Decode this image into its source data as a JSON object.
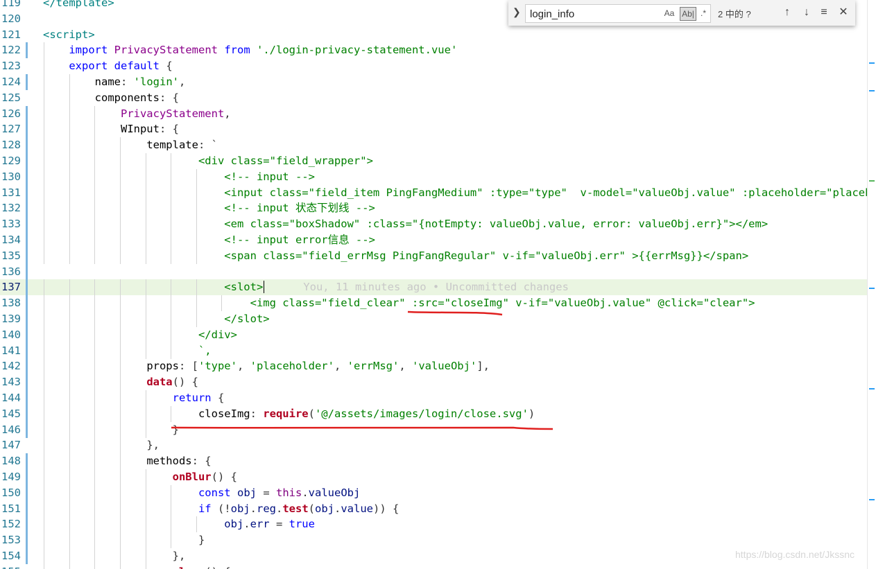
{
  "find_widget": {
    "query": "login_info",
    "match_case_label": "Aa",
    "whole_word_label": "Ab|",
    "regex_label": ".*",
    "result_count": "2 中的 ?"
  },
  "blame": "You, 11 minutes ago • Uncommitted changes",
  "watermark": "https://blog.csdn.net/Jkssnc",
  "line_numbers": [
    "119",
    "120",
    "121",
    "122",
    "123",
    "124",
    "125",
    "126",
    "127",
    "128",
    "129",
    "130",
    "131",
    "132",
    "133",
    "134",
    "135",
    "136",
    "137",
    "138",
    "139",
    "140",
    "141",
    "142",
    "143",
    "144",
    "145",
    "146",
    "147",
    "148",
    "149",
    "150",
    "151",
    "152",
    "153",
    "154",
    "155"
  ],
  "lines": [
    [
      [
        "</template>",
        "t-tag"
      ]
    ],
    [],
    [
      [
        "<script>",
        "t-tag"
      ]
    ],
    [
      [
        "    ",
        ""
      ],
      [
        "import",
        "t-kw"
      ],
      [
        " ",
        ""
      ],
      [
        "PrivacyStatement",
        "t-comp"
      ],
      [
        " ",
        ""
      ],
      [
        "from",
        "t-kw"
      ],
      [
        " ",
        ""
      ],
      [
        "'./login-privacy-statement.vue'",
        "t-str"
      ]
    ],
    [
      [
        "    ",
        ""
      ],
      [
        "export",
        "t-kw"
      ],
      [
        " ",
        ""
      ],
      [
        "default",
        "t-kw"
      ],
      [
        " {",
        "t-punc"
      ]
    ],
    [
      [
        "        ",
        ""
      ],
      [
        "name",
        "t-prop"
      ],
      [
        ": ",
        "t-punc"
      ],
      [
        "'login'",
        "t-str"
      ],
      [
        ",",
        "t-punc"
      ]
    ],
    [
      [
        "        ",
        ""
      ],
      [
        "components",
        "t-prop"
      ],
      [
        ": {",
        "t-punc"
      ]
    ],
    [
      [
        "            ",
        ""
      ],
      [
        "PrivacyStatement",
        "t-comp"
      ],
      [
        ",",
        "t-punc"
      ]
    ],
    [
      [
        "            ",
        ""
      ],
      [
        "WInput",
        "t-prop"
      ],
      [
        ": {",
        "t-punc"
      ]
    ],
    [
      [
        "                ",
        ""
      ],
      [
        "template",
        "t-prop"
      ],
      [
        ": `",
        "t-punc"
      ]
    ],
    [
      [
        "                        ",
        ""
      ],
      [
        "<div class=\"field_wrapper\">",
        "t-str"
      ]
    ],
    [
      [
        "                            ",
        ""
      ],
      [
        "<!-- input -->",
        "t-str"
      ]
    ],
    [
      [
        "                            ",
        ""
      ],
      [
        "<input class=\"field_item PingFangMedium\" :type=\"type\"  v-model=\"valueObj.value\" :placeholder=\"placeholder\"",
        "t-str"
      ]
    ],
    [
      [
        "                            ",
        ""
      ],
      [
        "<!-- input 状态下划线 -->",
        "t-str"
      ]
    ],
    [
      [
        "                            ",
        ""
      ],
      [
        "<em class=\"boxShadow\" :class=\"{notEmpty: valueObj.value, error: valueObj.err}\"></em>",
        "t-str"
      ]
    ],
    [
      [
        "                            ",
        ""
      ],
      [
        "<!-- input error信息 -->",
        "t-str"
      ]
    ],
    [
      [
        "                            ",
        ""
      ],
      [
        "<span class=\"field_errMsg PingFangRegular\" v-if=\"valueObj.err\" >{{errMsg}}</span>",
        "t-str"
      ]
    ],
    [],
    [
      [
        "                            ",
        ""
      ],
      [
        "<slot>",
        "t-str"
      ]
    ],
    [
      [
        "                                ",
        ""
      ],
      [
        "<img class=\"field_clear\" :src=\"closeImg\" v-if=\"valueObj.value\" @click=\"clear\">",
        "t-str"
      ]
    ],
    [
      [
        "                            ",
        ""
      ],
      [
        "</slot>",
        "t-str"
      ]
    ],
    [
      [
        "                        ",
        ""
      ],
      [
        "</div>",
        "t-str"
      ]
    ],
    [
      [
        "                        ",
        ""
      ],
      [
        "`,",
        "t-str"
      ]
    ],
    [
      [
        "                ",
        ""
      ],
      [
        "props",
        "t-prop"
      ],
      [
        ": [",
        "t-punc"
      ],
      [
        "'type'",
        "t-str"
      ],
      [
        ", ",
        "t-punc"
      ],
      [
        "'placeholder'",
        "t-str"
      ],
      [
        ", ",
        "t-punc"
      ],
      [
        "'errMsg'",
        "t-str"
      ],
      [
        ", ",
        "t-punc"
      ],
      [
        "'valueObj'",
        "t-str"
      ],
      [
        "],",
        "t-punc"
      ]
    ],
    [
      [
        "                ",
        ""
      ],
      [
        "data",
        "t-fn"
      ],
      [
        "() {",
        "t-punc"
      ]
    ],
    [
      [
        "                    ",
        ""
      ],
      [
        "return",
        "t-kw"
      ],
      [
        " {",
        "t-punc"
      ]
    ],
    [
      [
        "                        ",
        ""
      ],
      [
        "closeImg",
        "t-prop"
      ],
      [
        ": ",
        "t-punc"
      ],
      [
        "require",
        "t-fn"
      ],
      [
        "(",
        "t-punc"
      ],
      [
        "'@/assets/images/login/close.svg'",
        "t-str"
      ],
      [
        ")",
        "t-punc"
      ]
    ],
    [
      [
        "                    ",
        ""
      ],
      [
        "}",
        "t-punc"
      ]
    ],
    [
      [
        "                ",
        ""
      ],
      [
        "},",
        "t-punc"
      ]
    ],
    [
      [
        "                ",
        ""
      ],
      [
        "methods",
        "t-prop"
      ],
      [
        ": {",
        "t-punc"
      ]
    ],
    [
      [
        "                    ",
        ""
      ],
      [
        "onBlur",
        "t-fn"
      ],
      [
        "() {",
        "t-punc"
      ]
    ],
    [
      [
        "                        ",
        ""
      ],
      [
        "const",
        "t-kw"
      ],
      [
        " ",
        ""
      ],
      [
        "obj",
        "t-id"
      ],
      [
        " = ",
        "t-punc"
      ],
      [
        "this",
        "t-this"
      ],
      [
        ".",
        "t-punc"
      ],
      [
        "valueObj",
        "t-id"
      ]
    ],
    [
      [
        "                        ",
        ""
      ],
      [
        "if",
        "t-kw"
      ],
      [
        " (!",
        "t-punc"
      ],
      [
        "obj",
        "t-id"
      ],
      [
        ".",
        "t-punc"
      ],
      [
        "reg",
        "t-id"
      ],
      [
        ".",
        "t-punc"
      ],
      [
        "test",
        "t-fn"
      ],
      [
        "(",
        "t-punc"
      ],
      [
        "obj",
        "t-id"
      ],
      [
        ".",
        "t-punc"
      ],
      [
        "value",
        "t-id"
      ],
      [
        ")) {",
        "t-punc"
      ]
    ],
    [
      [
        "                            ",
        ""
      ],
      [
        "obj",
        "t-id"
      ],
      [
        ".",
        "t-punc"
      ],
      [
        "err",
        "t-id"
      ],
      [
        " = ",
        "t-punc"
      ],
      [
        "true",
        "t-bool"
      ]
    ],
    [
      [
        "                        ",
        ""
      ],
      [
        "}",
        "t-punc"
      ]
    ],
    [
      [
        "                    ",
        ""
      ],
      [
        "},",
        "t-punc"
      ]
    ],
    [
      [
        "                    ",
        ""
      ],
      [
        "clear",
        "t-fn"
      ],
      [
        "() {",
        "t-punc"
      ]
    ]
  ]
}
